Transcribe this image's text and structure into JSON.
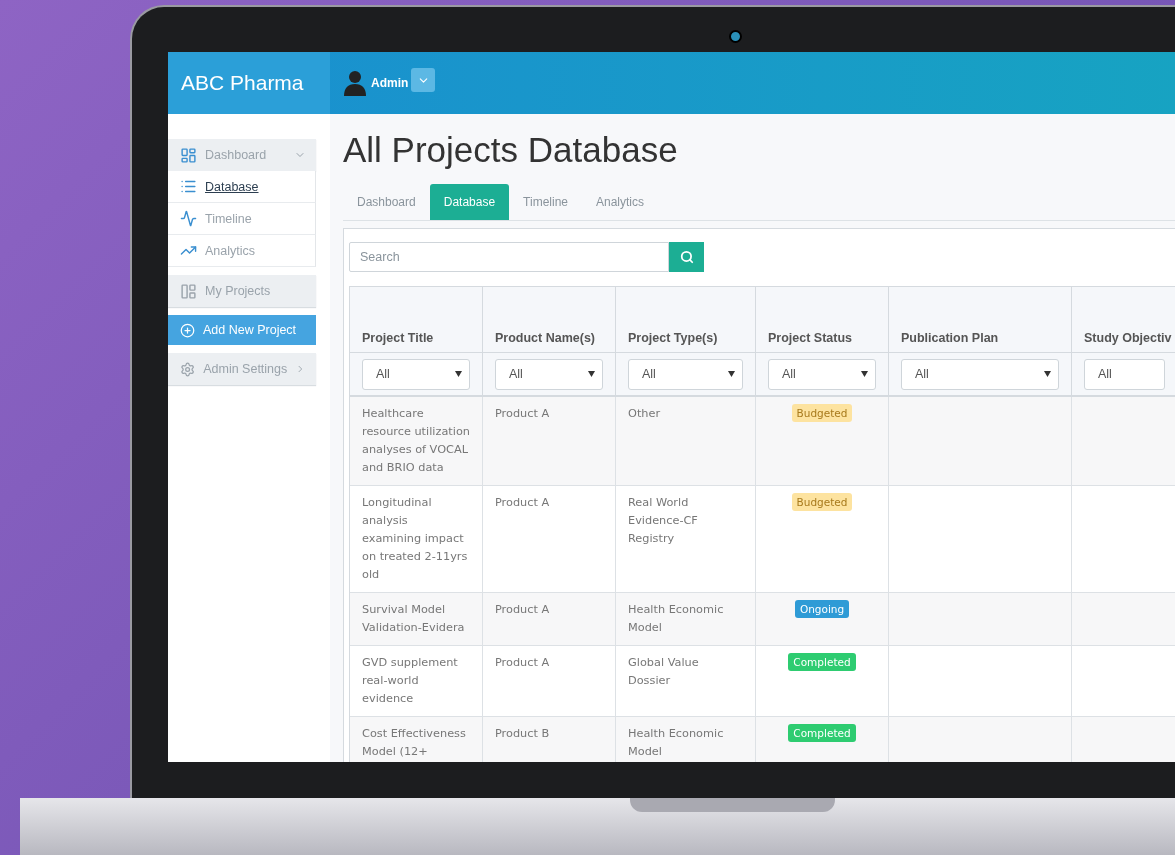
{
  "header": {
    "brand": "ABC Pharma",
    "user": "Admin"
  },
  "sidebar": {
    "items": [
      {
        "kind": "group",
        "label": "Dashboard",
        "expanded": true,
        "children": [
          {
            "label": "Database",
            "selected": true
          },
          {
            "label": "Timeline",
            "selected": false
          },
          {
            "label": "Analytics",
            "selected": false
          }
        ]
      },
      {
        "kind": "group",
        "label": "My Projects"
      },
      {
        "kind": "action",
        "label": "Add New Project"
      },
      {
        "kind": "group",
        "label": "Admin Settings",
        "expanded": false
      }
    ]
  },
  "page": {
    "title": "All Projects Database"
  },
  "tabs": [
    {
      "label": "Dashboard",
      "selected": false
    },
    {
      "label": "Database",
      "selected": true
    },
    {
      "label": "Timeline",
      "selected": false
    },
    {
      "label": "Analytics",
      "selected": false
    }
  ],
  "search": {
    "placeholder": "Search"
  },
  "table": {
    "columns": [
      {
        "label": "Project Title",
        "filter": "All"
      },
      {
        "label": "Product Name(s)",
        "filter": "All"
      },
      {
        "label": "Project Type(s)",
        "filter": "All"
      },
      {
        "label": "Project Status",
        "filter": "All"
      },
      {
        "label": "Publication Plan",
        "filter": "All"
      },
      {
        "label": "Study Objectiv",
        "filter": "All"
      }
    ],
    "rows": [
      {
        "title": "Healthcare resource utilization analyses of VOCAL and BRIO data",
        "product": "Product A",
        "type": "Other",
        "status": {
          "label": "Budgeted",
          "color": "#fde3a0"
        }
      },
      {
        "title": "Longitudinal analysis examining impact on treated 2-11yrs old",
        "product": "Product A",
        "type": "Real World Evidence-CF Registry",
        "status": {
          "label": "Budgeted",
          "color": "#fde3a0"
        }
      },
      {
        "title": "Survival Model Validation-Evidera",
        "product": "Product A",
        "type": "Health Economic Model",
        "status": {
          "label": "Ongoing",
          "color": "#2f9bd6"
        }
      },
      {
        "title": "GVD supplement real-world evidence",
        "product": "Product A",
        "type": "Global Value Dossier",
        "status": {
          "label": "Completed",
          "color": "#2ecc71"
        }
      },
      {
        "title": "Cost Effectiveness Model (12+",
        "product": "Product B",
        "type": "Health Economic Model",
        "status": {
          "label": "Completed",
          "color": "#2ecc71"
        }
      }
    ]
  }
}
